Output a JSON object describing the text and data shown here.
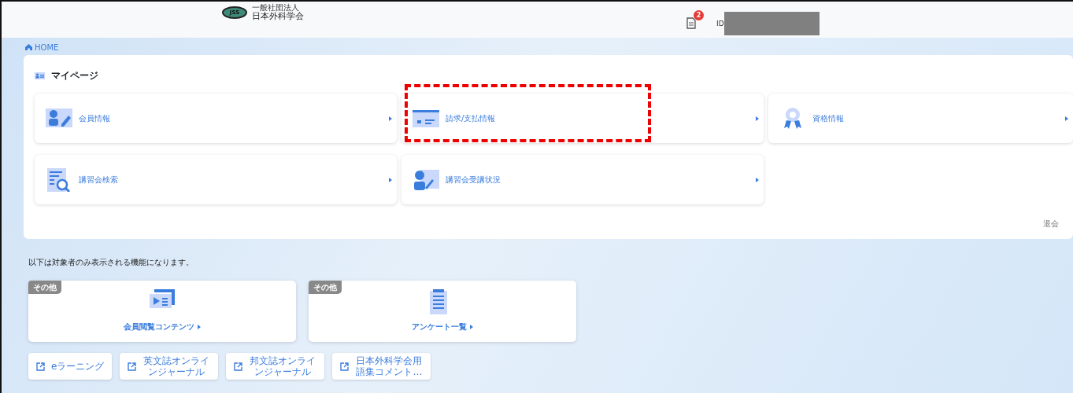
{
  "header": {
    "logo_subtitle": "一般社団法人",
    "logo_title": "日本外科学会",
    "logo_mark": "JSS",
    "notification_count": "2",
    "id_label": "ID"
  },
  "breadcrumb": {
    "label": "HOME"
  },
  "mypage": {
    "title": "マイページ",
    "items": [
      {
        "label": "会員情報",
        "highlighted": false
      },
      {
        "label": "請求/支払情報",
        "highlighted": true
      },
      {
        "label": "資格情報",
        "highlighted": false
      },
      {
        "label": "講習会検索",
        "highlighted": false
      },
      {
        "label": "講習会受講状況",
        "highlighted": false
      }
    ],
    "withdraw_link": "退会"
  },
  "notice": "以下は対象者のみ表示される機能になります。",
  "feature_cards": [
    {
      "tag": "その他",
      "label": "会員閲覧コンテンツ"
    },
    {
      "tag": "その他",
      "label": "アンケート一覧"
    }
  ],
  "external_links": [
    {
      "label": "eラーニング"
    },
    {
      "label": "英文誌オンラインジャーナル"
    },
    {
      "label": "邦文誌オンラインジャーナル"
    },
    {
      "label": "日本外科学会用語集コメント…"
    }
  ]
}
